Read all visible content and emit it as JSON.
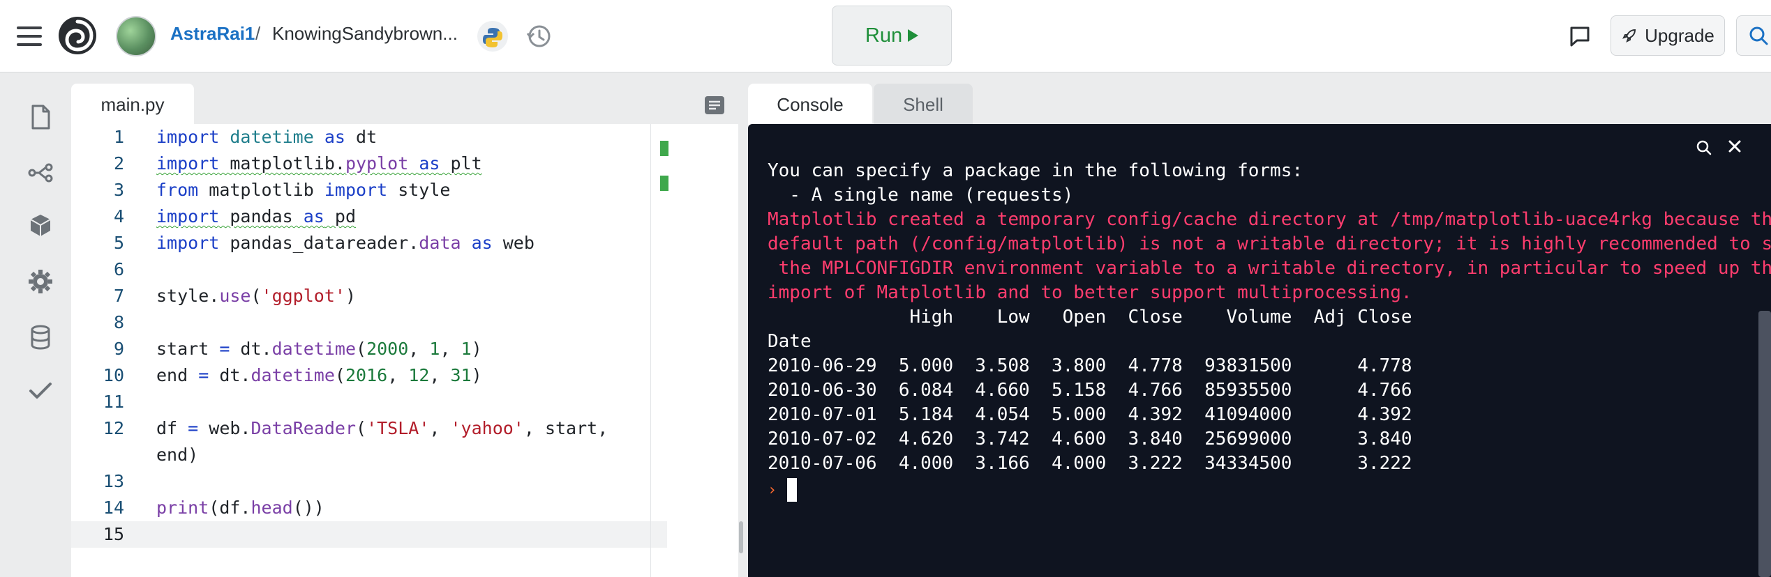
{
  "header": {
    "username": "AstraRai1",
    "separator": "/",
    "repl_name": "KnowingSandybrown...",
    "run_label": "Run",
    "upgrade_label": "Upgrade"
  },
  "editor": {
    "file_tab": "main.py",
    "lines": [
      {
        "n": "1"
      },
      {
        "n": "2"
      },
      {
        "n": "3"
      },
      {
        "n": "4"
      },
      {
        "n": "5"
      },
      {
        "n": "6"
      },
      {
        "n": "7"
      },
      {
        "n": "8"
      },
      {
        "n": "9"
      },
      {
        "n": "10"
      },
      {
        "n": "11"
      },
      {
        "n": "12"
      },
      {
        "n": "13"
      },
      {
        "n": "14"
      },
      {
        "n": "15"
      }
    ]
  },
  "console": {
    "tabs": [
      "Console",
      "Shell"
    ],
    "lines": [
      "You can specify a package in the following forms:",
      "  - A single name (requests)",
      "Matplotlib created a temporary config/cache directory at /tmp/matplotlib-uace4rkg because the",
      "default path (/config/matplotlib) is not a writable directory; it is highly recommended to set",
      " the MPLCONFIGDIR environment variable to a writable directory, in particular to speed up the",
      "import of Matplotlib and to better support multiprocessing.",
      "             High    Low   Open  Close    Volume  Adj Close",
      "Date",
      "2010-06-29  5.000  3.508  3.800  4.778  93831500      4.778",
      "2010-06-30  6.084  4.660  5.158  4.766  85935500      4.766",
      "2010-07-01  5.184  4.054  5.000  4.392  41094000      4.392",
      "2010-07-02  4.620  3.742  4.600  3.840  25699000      3.840",
      "2010-07-06  4.000  3.166  4.000  3.222  34334500      3.222"
    ],
    "prompt": "›"
  },
  "colors": {
    "link": "#1b71c4",
    "run_green": "#1f8f3a",
    "console_bg": "#0f1420",
    "error_red": "#ff3d6e",
    "prompt_orange": "#ff6a2e"
  },
  "icons": {
    "sidebar": [
      "file-icon",
      "git-branch-icon",
      "package-icon",
      "gear-icon",
      "database-icon",
      "checkmark-icon"
    ],
    "header": [
      "menu-icon",
      "replit-logo-icon",
      "python-icon",
      "history-icon",
      "chat-icon",
      "rocket-icon",
      "search-icon"
    ]
  }
}
